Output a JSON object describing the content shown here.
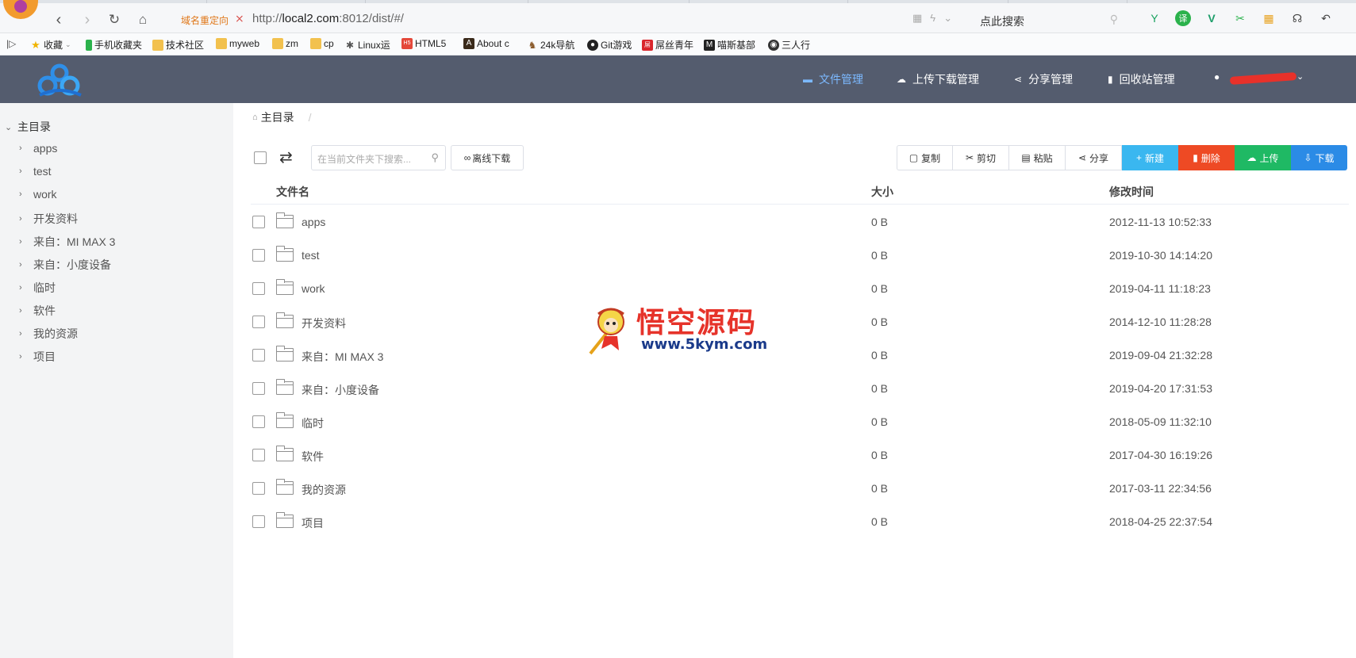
{
  "browser": {
    "redirect_label": "域名重定向",
    "url_prefix": "http://",
    "url_host": "local2.com",
    "url_rest": ":8012/dist/#/",
    "search_text": "点此搜索"
  },
  "bookmarks": [
    {
      "label": "收藏",
      "icon": "star-icon"
    },
    {
      "label": "手机收藏夹",
      "icon": "phone-icon"
    },
    {
      "label": "技术社区",
      "icon": "folder-icon"
    },
    {
      "label": "myweb",
      "icon": "folder-icon"
    },
    {
      "label": "zm",
      "icon": "folder-icon"
    },
    {
      "label": "cp",
      "icon": "folder-icon"
    },
    {
      "label": "Linux运",
      "icon": "site-icon"
    },
    {
      "label": "HTML5",
      "icon": "site-icon"
    },
    {
      "label": "About c",
      "icon": "site-icon"
    },
    {
      "label": "24k导航",
      "icon": "site-icon"
    },
    {
      "label": "Git游戏",
      "icon": "github-icon"
    },
    {
      "label": "屌丝青年",
      "icon": "site-icon"
    },
    {
      "label": "喵斯基部",
      "icon": "site-icon"
    },
    {
      "label": "三人行",
      "icon": "site-icon"
    }
  ],
  "header": {
    "nav": [
      {
        "label": "文件管理",
        "icon": "folder-icon",
        "active": true
      },
      {
        "label": "上传下载管理",
        "icon": "cloud-icon",
        "active": false
      },
      {
        "label": "分享管理",
        "icon": "share-icon",
        "active": false
      },
      {
        "label": "回收站管理",
        "icon": "trash-icon",
        "active": false
      }
    ]
  },
  "sidebar": {
    "root": "主目录",
    "items": [
      "apps",
      "test",
      "work",
      "开发资料",
      "来自：MI MAX 3",
      "来自：小度设备",
      "临时",
      "软件",
      "我的资源",
      "项目"
    ]
  },
  "breadcrumb": {
    "root": "主目录",
    "sep": "/"
  },
  "toolbar": {
    "search_placeholder": "在当前文件夹下搜索...",
    "offline_download": "离线下载",
    "buttons": [
      {
        "label": "复制",
        "icon": "copy-icon",
        "style": "plain"
      },
      {
        "label": "剪切",
        "icon": "scissors-icon",
        "style": "plain"
      },
      {
        "label": "粘贴",
        "icon": "paste-icon",
        "style": "plain"
      },
      {
        "label": "分享",
        "icon": "share-icon",
        "style": "plain"
      },
      {
        "label": "新建",
        "icon": "plus-icon",
        "style": "filled",
        "color": "#3ab7f0"
      },
      {
        "label": "删除",
        "icon": "trash-icon",
        "style": "filled",
        "color": "#ee4a24"
      },
      {
        "label": "上传",
        "icon": "cloud-upload-icon",
        "style": "filled",
        "color": "#1fb964"
      },
      {
        "label": "下载",
        "icon": "download-icon",
        "style": "filled",
        "color": "#2b8be6"
      }
    ]
  },
  "table": {
    "columns": [
      "文件名",
      "大小",
      "修改时间"
    ],
    "rows": [
      {
        "name": "apps",
        "size": "0 B",
        "modified": "2012-11-13 10:52:33"
      },
      {
        "name": "test",
        "size": "0 B",
        "modified": "2019-10-30 14:14:20"
      },
      {
        "name": "work",
        "size": "0 B",
        "modified": "2019-04-11 11:18:23"
      },
      {
        "name": "开发资料",
        "size": "0 B",
        "modified": "2014-12-10 11:28:28"
      },
      {
        "name": "来自：MI MAX 3",
        "size": "0 B",
        "modified": "2019-09-04 21:32:28"
      },
      {
        "name": "来自：小度设备",
        "size": "0 B",
        "modified": "2019-04-20 17:31:53"
      },
      {
        "name": "临时",
        "size": "0 B",
        "modified": "2018-05-09 11:32:10"
      },
      {
        "name": "软件",
        "size": "0 B",
        "modified": "2017-04-30 16:19:26"
      },
      {
        "name": "我的资源",
        "size": "0 B",
        "modified": "2017-03-11 22:34:56"
      },
      {
        "name": "项目",
        "size": "0 B",
        "modified": "2018-04-25 22:37:54"
      }
    ]
  },
  "watermark": {
    "title": "悟空源码",
    "url": "www.5kym.com"
  },
  "colors": {
    "header_bg": "#545c6e",
    "active_nav": "#7cb9ff",
    "sidebar_bg": "#f3f4f5"
  }
}
